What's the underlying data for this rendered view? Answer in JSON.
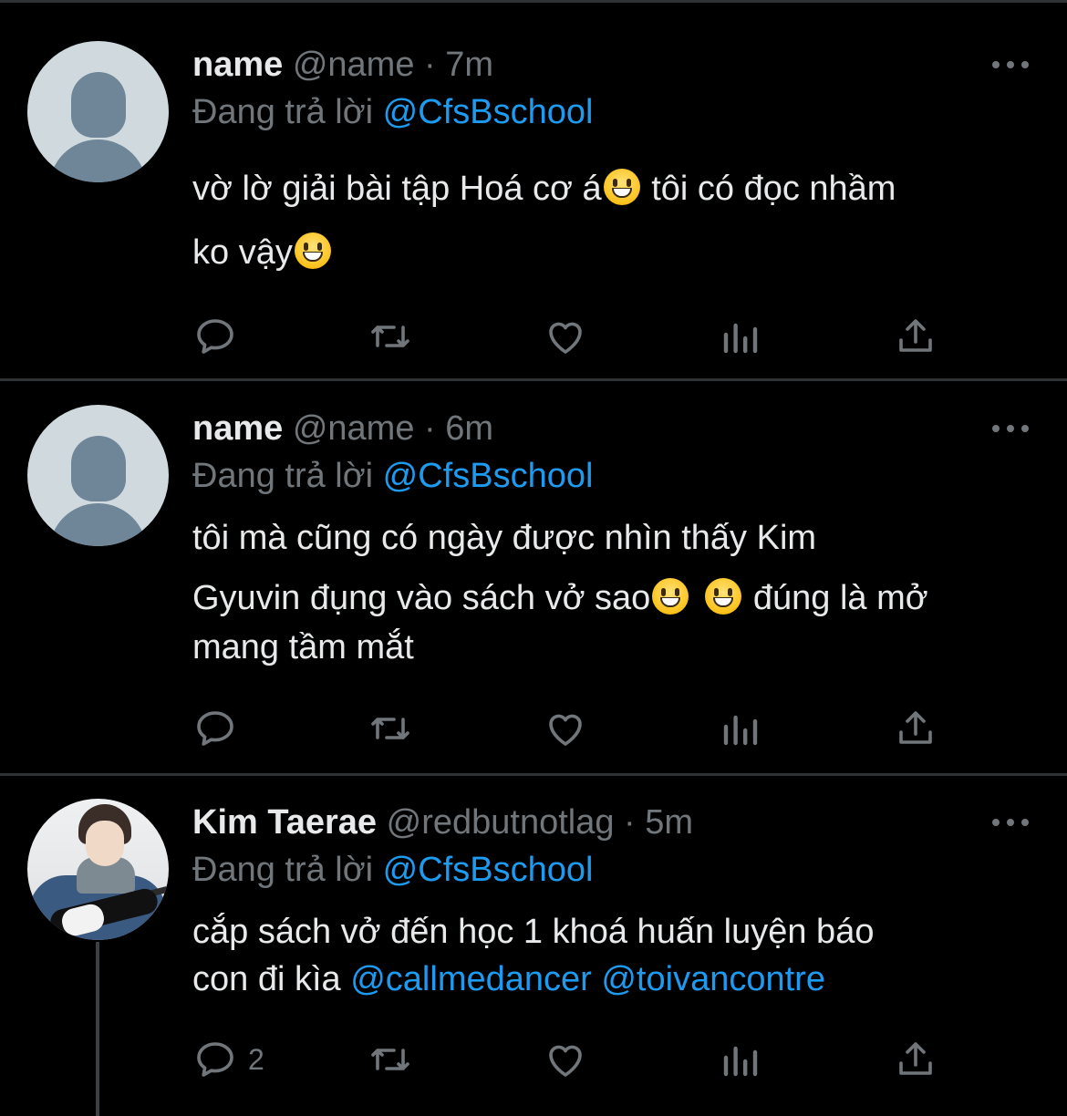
{
  "tweets": [
    {
      "name": "name",
      "handle": "@name",
      "time": "7m",
      "replying_prefix": "Đang trả lời",
      "replying_to": "@CfsBschool",
      "line1a": "vờ lờ giải bài tập Hoá cơ á",
      "line1b": " tôi có đọc nhầm",
      "line2a": "ko vậy",
      "avatar": "default-avatar"
    },
    {
      "name": "name",
      "handle": "@name",
      "time": "6m",
      "replying_prefix": "Đang trả lời",
      "replying_to": "@CfsBschool",
      "line1": "tôi mà cũng có ngày được nhìn thấy Kim",
      "line2a": "Gyuvin đụng vào sách vở sao",
      "line2b": " đúng là mở",
      "line3": "mang tầm mắt",
      "avatar": "default-avatar"
    },
    {
      "name": "Kim Taerae",
      "handle": "@redbutnotlag",
      "time": "5m",
      "replying_prefix": "Đang trả lời",
      "replying_to": "@CfsBschool",
      "line1": "cắp sách vở đến học 1 khoá huấn luyện báo",
      "line2a": "con đi kìa",
      "mention1": "@callmedancer",
      "mention2": "@toivancontre",
      "reply_count": "2",
      "avatar": "photo-avatar"
    }
  ],
  "separator": " · ",
  "icons": [
    "reply-icon",
    "retweet-icon",
    "like-icon",
    "views-icon",
    "share-icon",
    "more-icon"
  ],
  "colors": {
    "background": "#000000",
    "text": "#e7e9ea",
    "muted": "#71767b",
    "accent": "#1d9bf0"
  }
}
